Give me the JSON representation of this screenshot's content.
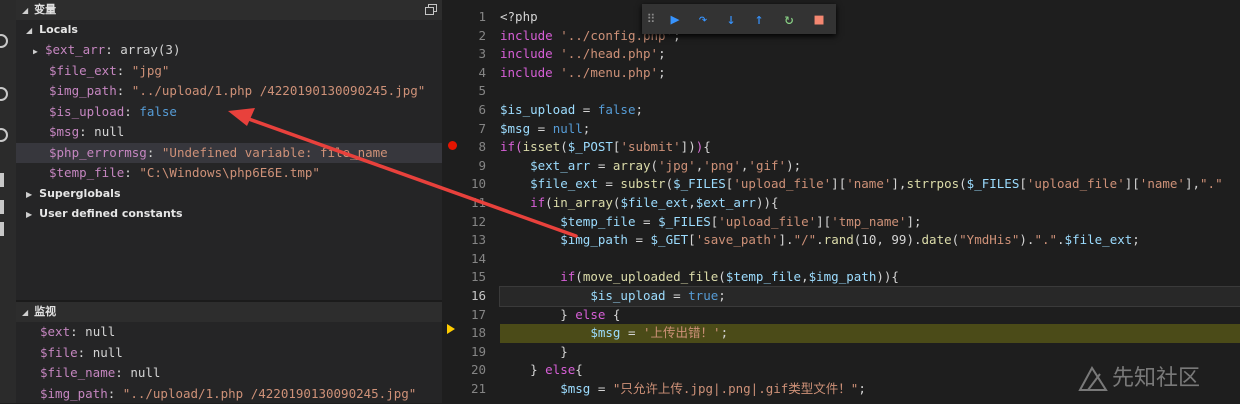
{
  "variables": {
    "title": "变量",
    "locals_label": "Locals",
    "items": [
      {
        "name": "$ext_arr",
        "value": "array(3)",
        "expandable": true
      },
      {
        "name": "$file_ext",
        "value": "\"jpg\""
      },
      {
        "name": "$img_path",
        "value": "\"../upload/1.php /4220190130090245.jpg\""
      },
      {
        "name": "$is_upload",
        "value": "false"
      },
      {
        "name": "$msg",
        "value": "null"
      },
      {
        "name": "$php_errormsg",
        "value": "\"Undefined variable: file_name"
      },
      {
        "name": "$temp_file",
        "value": "\"C:\\Windows\\php6E6E.tmp\""
      }
    ],
    "superglobals_label": "Superglobals",
    "constants_label": "User defined constants"
  },
  "watch": {
    "title": "监视",
    "items": [
      {
        "name": "$ext",
        "value": "null"
      },
      {
        "name": "$file",
        "value": "null"
      },
      {
        "name": "$file_name",
        "value": "null"
      },
      {
        "name": "$img_path",
        "value": "\"../upload/1.php /4220190130090245.jpg\""
      }
    ]
  },
  "debug_toolbar": {
    "buttons": [
      "drag-handle",
      "continue",
      "step-over",
      "step-into",
      "step-out",
      "restart",
      "stop"
    ],
    "colors": {
      "blue": "#3794ff",
      "green": "#89d185",
      "red": "#f48771"
    }
  },
  "editor": {
    "line_numbers": [
      "1",
      "2",
      "3",
      "4",
      "5",
      "6",
      "7",
      "8",
      "9",
      "10",
      "11",
      "12",
      "13",
      "14",
      "15",
      "16",
      "17",
      "18",
      "19",
      "20",
      "21"
    ],
    "current_line": "16",
    "paused_line": "18",
    "breakpoint_line": "8"
  },
  "watermark": {
    "text": "先知社区"
  },
  "colors": {
    "arrow": "#e8413c",
    "breakpoint": "#e51400",
    "pause_pointer": "#ffcc00"
  }
}
